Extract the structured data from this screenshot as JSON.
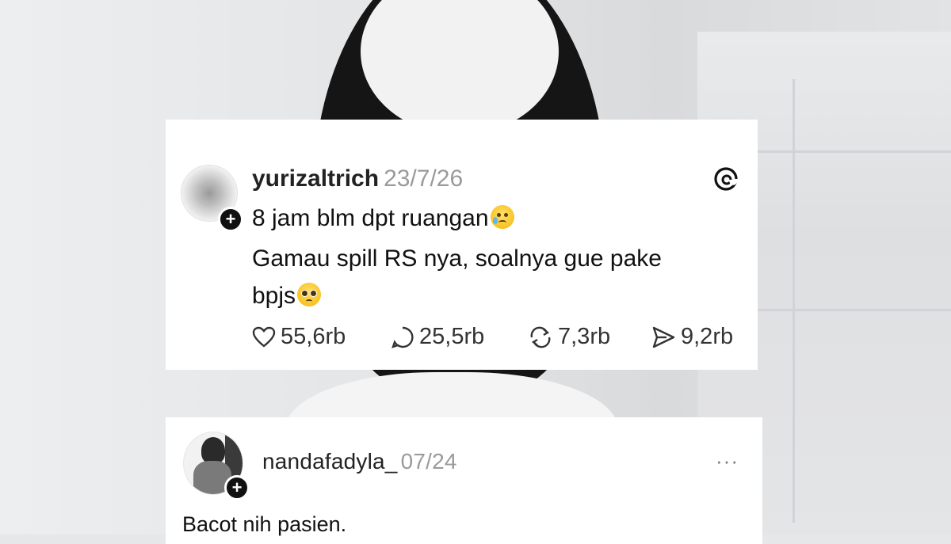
{
  "post": {
    "username": "yurizaltrich",
    "date": "23/7/26",
    "app_icon": "threads-icon",
    "line1": "8 jam blm dpt ruangan",
    "line1_emoji": "crying-face-icon",
    "line2": "Gamau spill RS nya, soalnya gue pake",
    "line3": "bpjs",
    "line3_emoji": "pleading-face-icon",
    "likes": "55,6rb",
    "replies": "25,5rb",
    "reposts": "7,3rb",
    "shares": "9,2rb"
  },
  "reply": {
    "username": "nandafadyla_",
    "date": "07/24",
    "more": "···",
    "text": "Bacot nih pasien."
  },
  "colors": {
    "text": "#111111",
    "muted": "#9a9a9a",
    "card": "#ffffff"
  }
}
